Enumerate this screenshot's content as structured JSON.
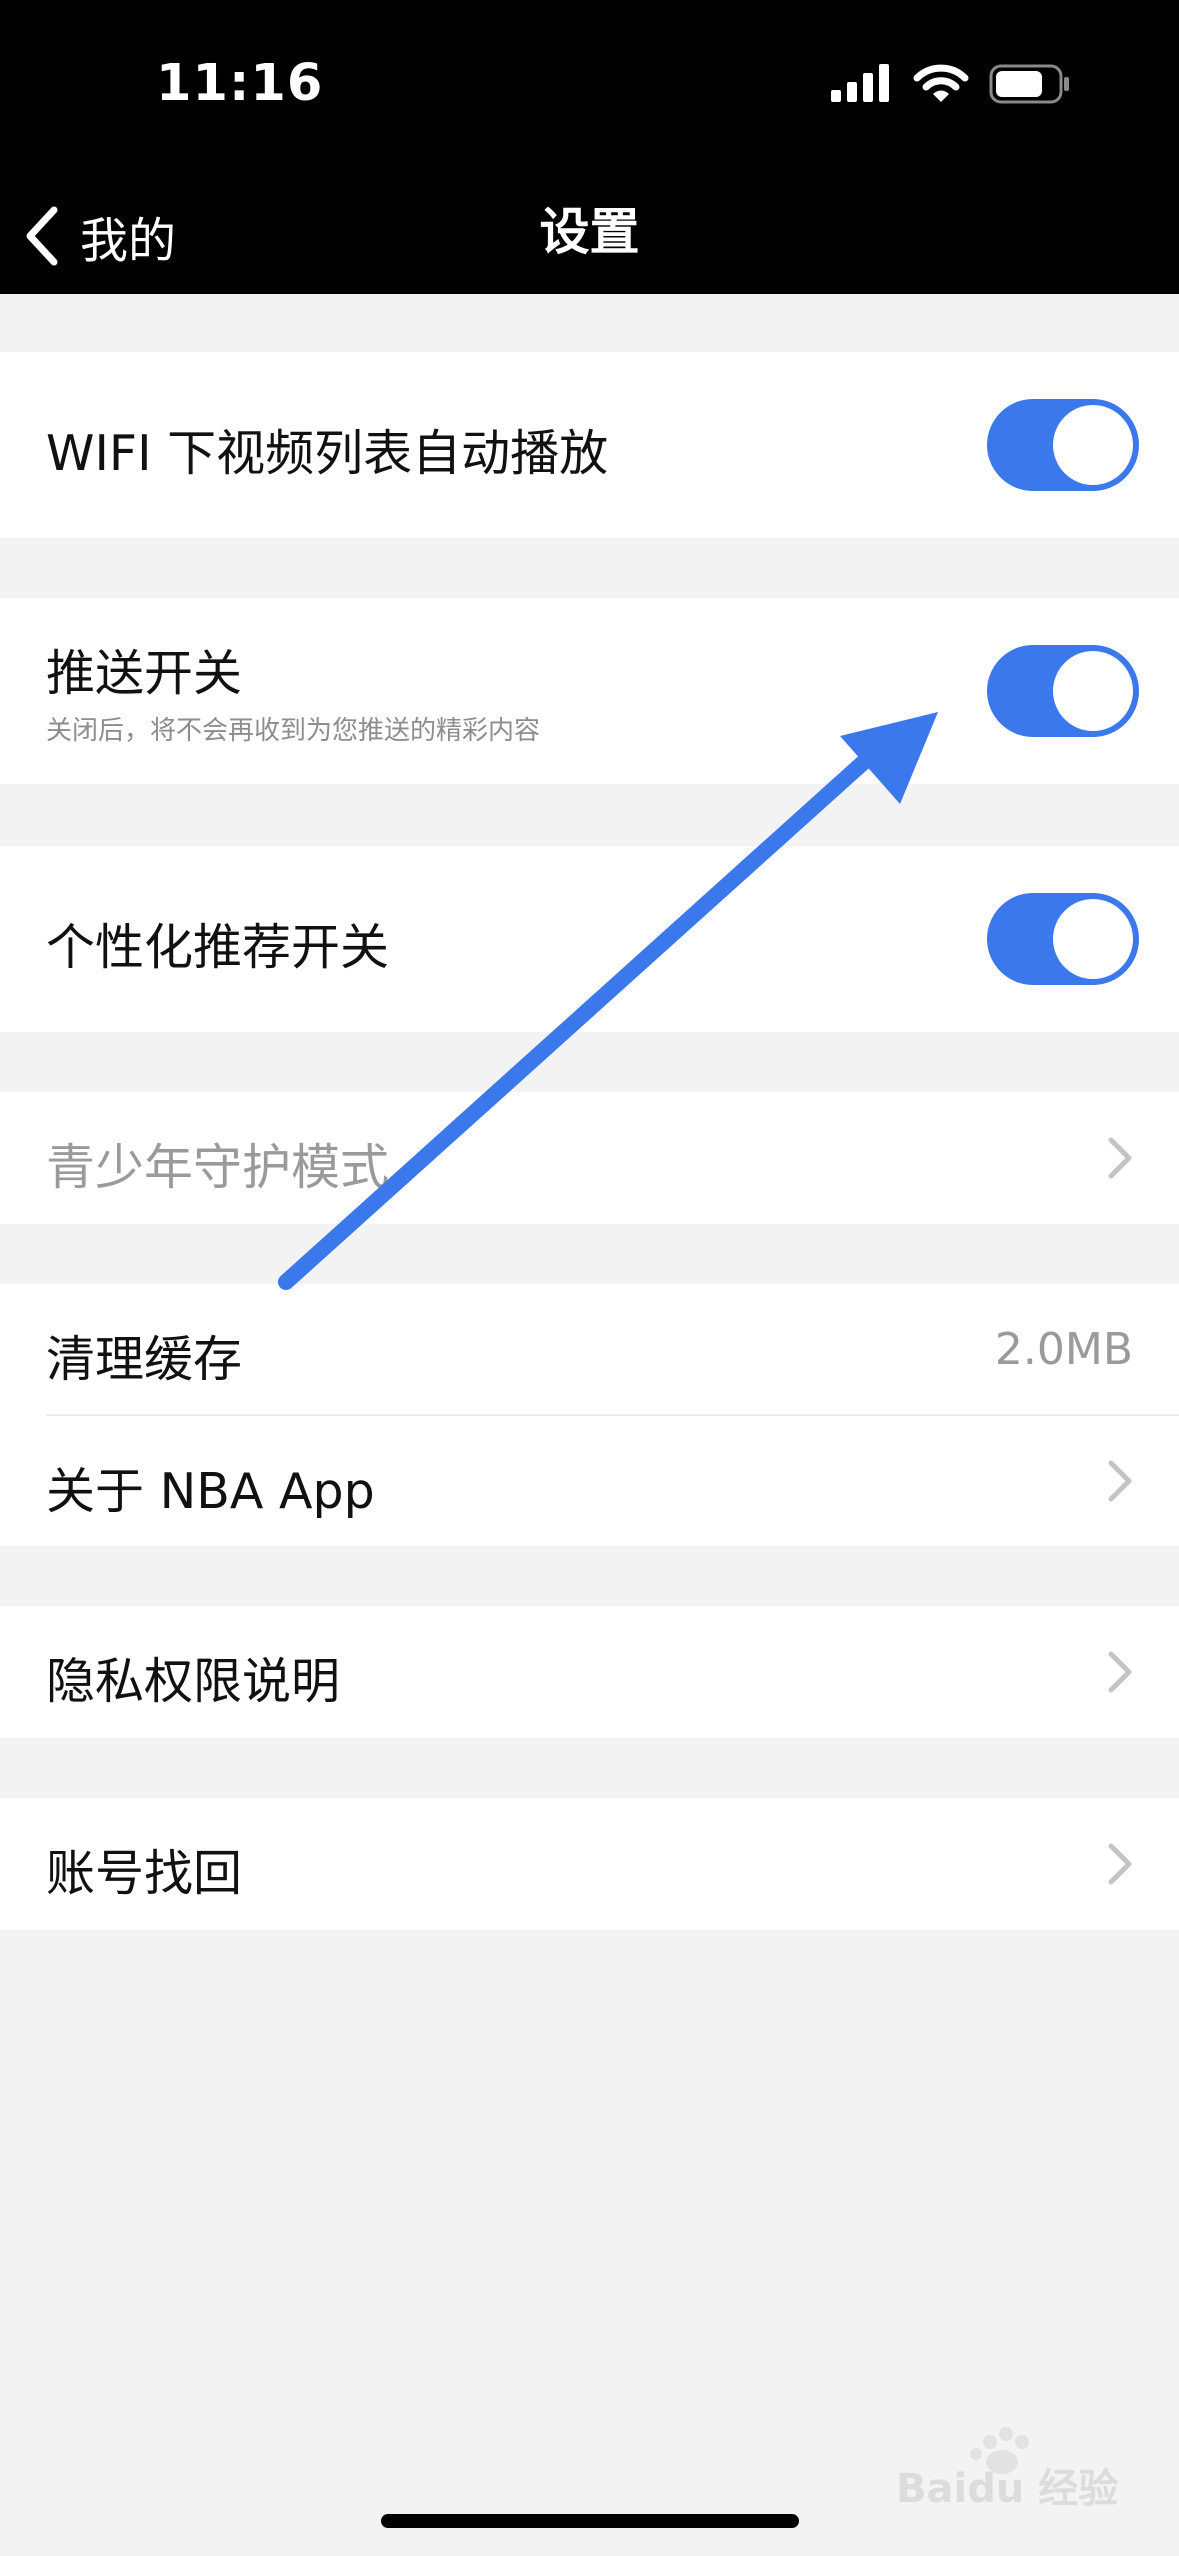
{
  "status_bar": {
    "time": "11:16"
  },
  "nav": {
    "back_label": "我的",
    "title": "设置"
  },
  "settings": {
    "wifi_autoplay": {
      "label": "WIFI 下视频列表自动播放",
      "enabled": true
    },
    "push": {
      "label": "推送开关",
      "description": "关闭后，将不会再收到为您推送的精彩内容",
      "enabled": true
    },
    "personalized": {
      "label": "个性化推荐开关",
      "enabled": true
    },
    "youth_mode": {
      "label": "青少年守护模式"
    },
    "clear_cache": {
      "label": "清理缓存",
      "value": "2.0MB"
    },
    "about": {
      "label": "关于 NBA App"
    },
    "privacy": {
      "label": "隐私权限说明"
    },
    "account_recovery": {
      "label": "账号找回"
    }
  },
  "watermark": {
    "text": "Baidu 经验"
  },
  "colors": {
    "toggle_on": "#3a78ec",
    "annotation_arrow": "#3a78ec",
    "header_bg": "#000000",
    "page_bg": "#f3f3f3"
  }
}
